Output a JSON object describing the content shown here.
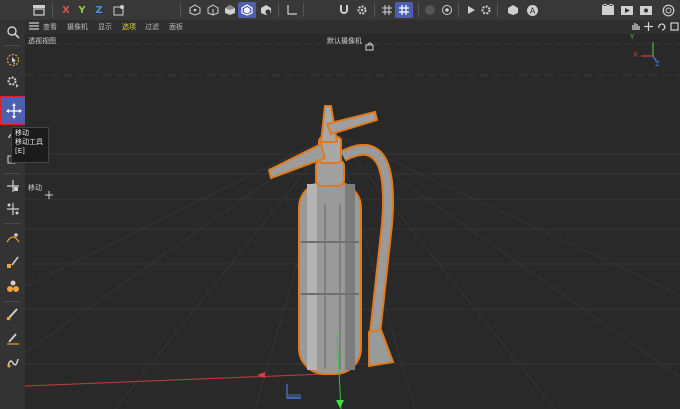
{
  "toolbar": {
    "axis_x": "X",
    "axis_y": "Y",
    "axis_z": "Z",
    "colors": {
      "x": "#e05050",
      "y": "#8ccf3c",
      "z": "#4d8fe6",
      "active": "#4f5fb0"
    },
    "icons": [
      "undo-stack-icon",
      "x-axis-lock-icon",
      "y-axis-lock-icon",
      "z-axis-lock-icon",
      "coordinate-system-icon",
      "points-mode-icon",
      "edges-mode-icon",
      "polygons-mode-icon",
      "model-mode-icon",
      "texture-mode-icon",
      "axis-mode-icon",
      "magnet-icon",
      "settings-gear-icon",
      "snap-icon",
      "snap-grid-icon",
      "dim-circle-icon",
      "target-icon",
      "play-icon",
      "symmetry-icon",
      "gear-icon",
      "cube-deform-icon",
      "render-icon",
      "render-view-icon",
      "render-picture-queue-icon",
      "render-settings-icon",
      "spiral-icon"
    ]
  },
  "menu": {
    "hamburger_icon": "hamburger-menu-icon",
    "items": [
      "查看",
      "摄像机",
      "显示",
      "选项",
      "过滤",
      "面板"
    ],
    "active_index": 3
  },
  "viewport": {
    "name": "透视视图",
    "camera": "默认摄像机",
    "camera_icon": "camera-link-icon",
    "move_label": "移动",
    "nav_icons": [
      "pan-hand-icon",
      "move-arrows-icon",
      "rotate-icon",
      "fullscreen-icon"
    ],
    "axis_labels": {
      "x": "X",
      "y": "Y",
      "z": "Z"
    }
  },
  "tooltip": {
    "title": "移动",
    "line2": "移动工具",
    "shortcut": "[E]"
  },
  "sidebar": {
    "icons": [
      "search-icon",
      "live-select-icon",
      "gear-select-icon",
      "move-tool-icon",
      "rotate-tool-icon",
      "scale-tool-icon",
      "transform-icon",
      "scale-multi-icon",
      "spline-pen-icon",
      "spline-sketch-icon",
      "spline-arc-icon",
      "knife-icon",
      "brush-icon",
      "pen-icon",
      "sculpt-icon"
    ]
  }
}
